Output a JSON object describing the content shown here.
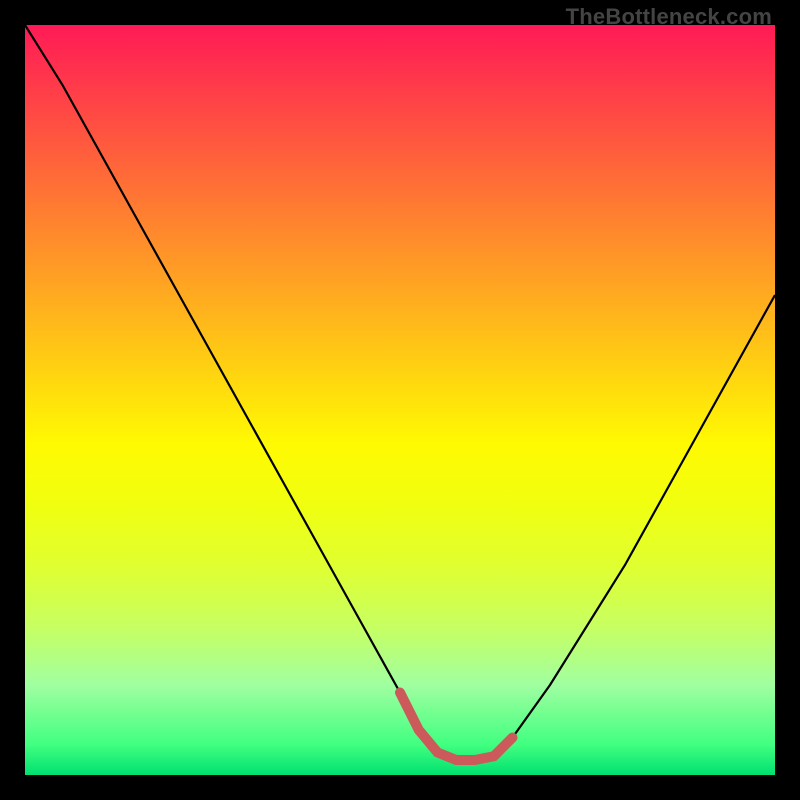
{
  "watermark": "TheBottleneck.com",
  "colors": {
    "background": "#000000",
    "curve": "#000000",
    "marker": "#cc5a5a",
    "gradient_top": "#ff1a56",
    "gradient_bottom": "#00e070"
  },
  "chart_data": {
    "type": "line",
    "title": "",
    "xlabel": "",
    "ylabel": "",
    "ylim": [
      0,
      100
    ],
    "x": [
      0.0,
      0.05,
      0.1,
      0.15,
      0.2,
      0.25,
      0.3,
      0.35,
      0.4,
      0.45,
      0.5,
      0.525,
      0.55,
      0.575,
      0.6,
      0.625,
      0.65,
      0.7,
      0.75,
      0.8,
      0.85,
      0.9,
      0.95,
      1.0
    ],
    "values": [
      100,
      92,
      83,
      74,
      65,
      56,
      47,
      38,
      29,
      20,
      11,
      6,
      3,
      2,
      2,
      2.5,
      5,
      12,
      20,
      28,
      37,
      46,
      55,
      64
    ],
    "marker_range_x": [
      0.5,
      0.65
    ],
    "annotations": []
  }
}
